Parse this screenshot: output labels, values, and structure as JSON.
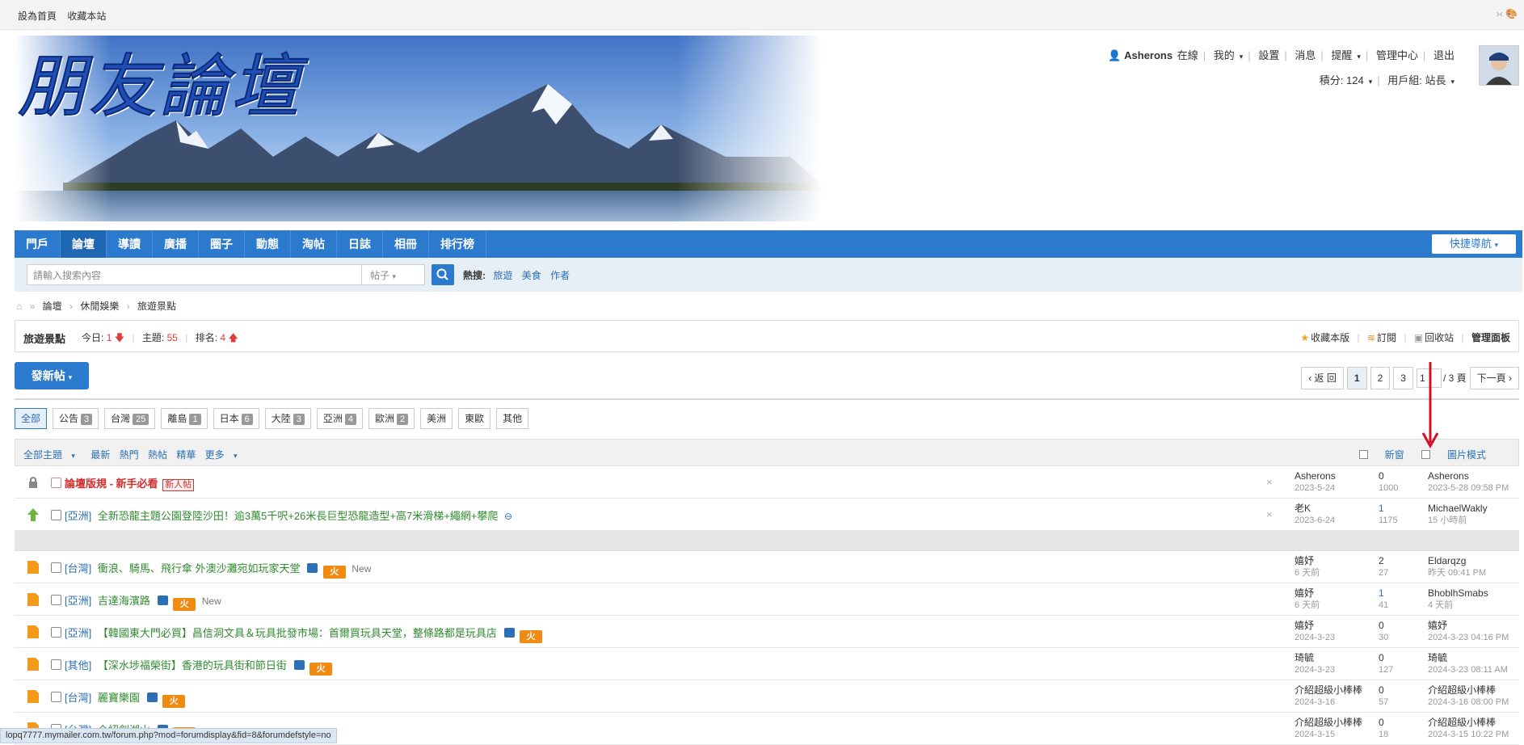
{
  "topbar": {
    "set_home": "設為首頁",
    "bookmark": "收藏本站",
    "right_ctrl": "›‹ 🎨"
  },
  "banner": {
    "title": "朋友論壇"
  },
  "user": {
    "name": "Asherons",
    "online": "在線",
    "menu": [
      "我的",
      "設置",
      "消息",
      "提醒",
      "管理中心",
      "退出"
    ],
    "points": "積分: 124",
    "group": "用戶組: 站長"
  },
  "nav": {
    "items": [
      "門戶",
      "論壇",
      "導讀",
      "廣播",
      "圈子",
      "動態",
      "淘帖",
      "日誌",
      "相冊",
      "排行榜"
    ],
    "active": "論壇",
    "quick": "快捷導航"
  },
  "search": {
    "placeholder": "請輸入搜索內容",
    "type": "帖子",
    "hot_label": "熱搜:",
    "hot": [
      "旅遊",
      "美食",
      "作者"
    ]
  },
  "breadcrumb": [
    "論壇",
    "休閒娛樂",
    "旅遊景點"
  ],
  "forum": {
    "name": "旅遊景點",
    "today_label": "今日:",
    "today": "1",
    "topics_label": "主題:",
    "topics": "55",
    "rank_label": "排名:",
    "rank": "4",
    "actions": [
      "收藏本版",
      "訂閱",
      "回收站",
      "管理面板"
    ]
  },
  "post_button": "發新帖",
  "pager": {
    "back": "返 回",
    "pages": [
      "1",
      "2",
      "3"
    ],
    "current": "1",
    "input_value": "1",
    "total": "/ 3 頁",
    "next": "下一頁"
  },
  "categories": [
    {
      "label": "全部",
      "count": ""
    },
    {
      "label": "公告",
      "count": "3"
    },
    {
      "label": "台灣",
      "count": "25"
    },
    {
      "label": "離島",
      "count": "1"
    },
    {
      "label": "日本",
      "count": "6"
    },
    {
      "label": "大陸",
      "count": "3"
    },
    {
      "label": "亞洲",
      "count": "4"
    },
    {
      "label": "歐洲",
      "count": "2"
    },
    {
      "label": "美洲",
      "count": ""
    },
    {
      "label": "東歐",
      "count": ""
    },
    {
      "label": "其他",
      "count": ""
    }
  ],
  "list_header": {
    "left": [
      "全部主題",
      "最新",
      "熱門",
      "熱帖",
      "精華",
      "更多"
    ],
    "new_window": "新窗",
    "image_mode": "圖片模式"
  },
  "threads": [
    {
      "type": "",
      "title": "論壇版規 - 新手必看",
      "badge": "新人帖",
      "author": "Asherons",
      "date": "2023-5-24",
      "replies": "0",
      "views": "1000",
      "last": "Asherons",
      "last_date": "2023-5-28 09:58 PM",
      "closable": true
    },
    {
      "type": "[亞洲]",
      "title": "全新恐龍主題公園登陸沙田！逾3萬5千呎+26米長巨型恐龍造型+高7米滑梯+繩網+攀爬",
      "author": "老K",
      "date": "2023-6-24",
      "replies": "1",
      "views": "1175",
      "last": "MichaelWakly",
      "last_date": "15 小時前",
      "closable": true
    },
    {
      "type": "[台灣]",
      "title": "衝浪、騎馬、飛行傘 外澳沙灘宛如玩家天堂",
      "author": "嬉妤",
      "date": "6 天前",
      "replies": "2",
      "views": "27",
      "last": "Eldarqzg",
      "last_date": "昨天 09:41 PM",
      "is_new": "New"
    },
    {
      "type": "[亞洲]",
      "title": "吉達海濱路",
      "author": "嬉妤",
      "date": "6 天前",
      "replies": "1",
      "views": "41",
      "last": "BhoblhSmabs",
      "last_date": "4 天前",
      "is_new": "New"
    },
    {
      "type": "[亞洲]",
      "title": "【韓國東大門必買】昌信洞文具＆玩具批發市場：首爾買玩具天堂，整條路都是玩具店",
      "author": "嬉妤",
      "date": "2024-3-23",
      "replies": "0",
      "views": "30",
      "last": "嬉妤",
      "last_date": "2024-3-23 04:16 PM"
    },
    {
      "type": "[其他]",
      "title": "【深水埗福榮街】香港的玩具街和節日街",
      "author": "琦毓",
      "date": "2024-3-23",
      "replies": "0",
      "views": "127",
      "last": "琦毓",
      "last_date": "2024-3-23 08:11 AM"
    },
    {
      "type": "[台灣]",
      "title": "麗寶樂園",
      "author": "介紹超級小棒棒",
      "date": "2024-3-16",
      "replies": "0",
      "views": "57",
      "last": "介紹超級小棒棒",
      "last_date": "2024-3-16 08:00 PM"
    },
    {
      "type": "[台灣]",
      "title": "介紹劍湖山",
      "author": "介紹超級小棒棒",
      "date": "2024-3-15",
      "replies": "0",
      "views": "18",
      "last": "介紹超級小棒棒",
      "last_date": "2024-3-15 10:22 PM"
    }
  ],
  "hot_icon": "火",
  "status_url": "lopq7777.mymailer.com.tw/forum.php?mod=forumdisplay&fid=8&forumdefstyle=no",
  "colors": {
    "primary": "#2b7acd",
    "green_title": "#2e8b2e",
    "red_title": "#d32d2d",
    "annotation": "#d0102a"
  }
}
